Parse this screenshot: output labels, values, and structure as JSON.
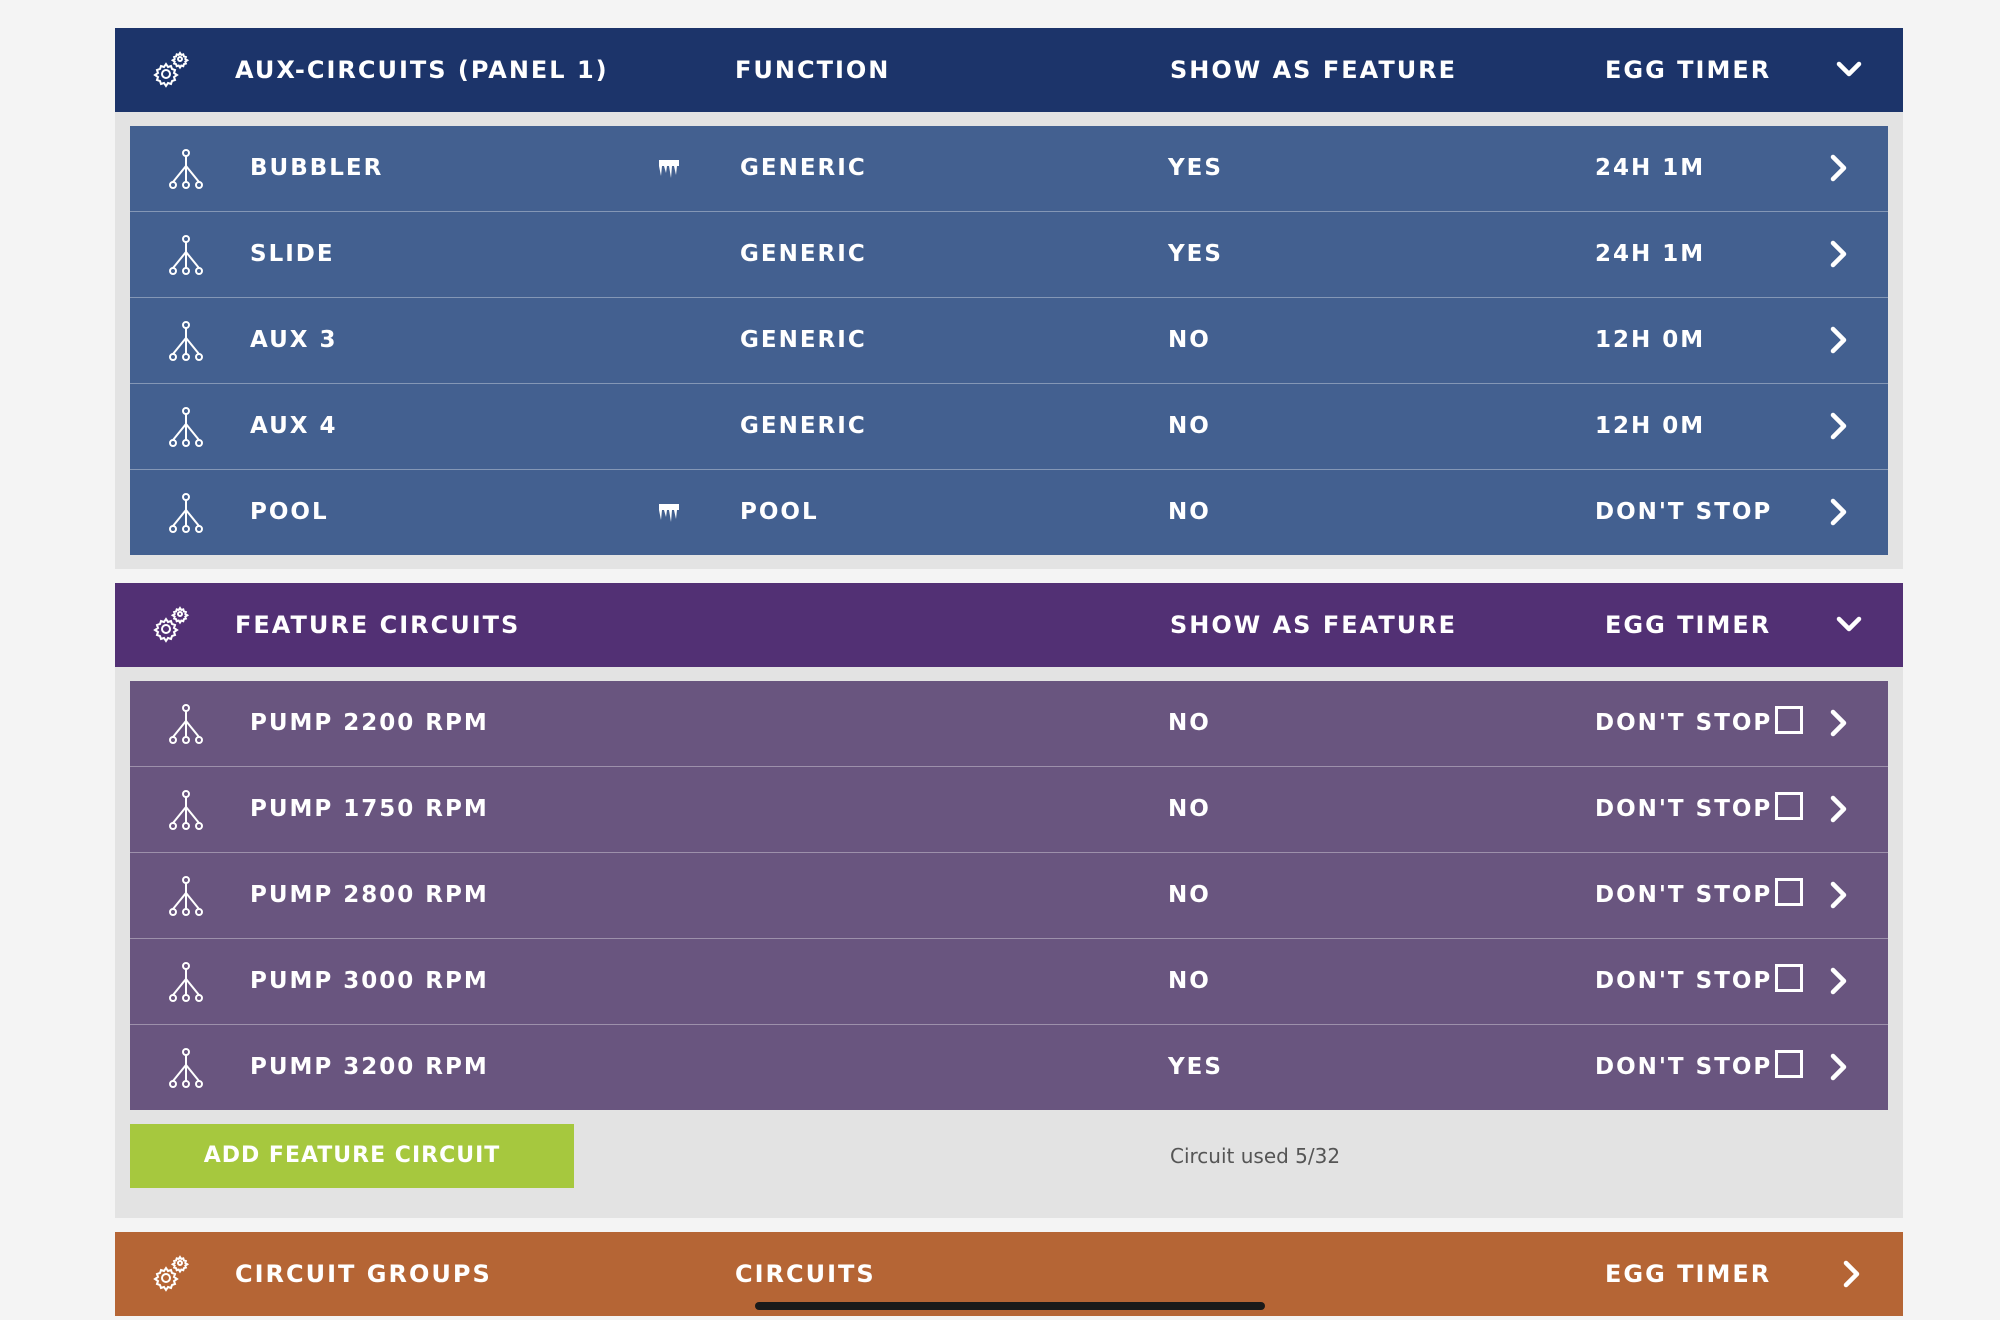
{
  "aux_section": {
    "title": "AUX-CIRCUITS (PANEL 1)",
    "col_function": "FUNCTION",
    "col_show": "SHOW AS FEATURE",
    "col_timer": "EGG TIMER",
    "rows": [
      {
        "name": "BUBBLER",
        "freeze": true,
        "function": "GENERIC",
        "show": "YES",
        "timer": "24H 1M"
      },
      {
        "name": "SLIDE",
        "freeze": false,
        "function": "GENERIC",
        "show": "YES",
        "timer": "24H 1M"
      },
      {
        "name": "AUX 3",
        "freeze": false,
        "function": "GENERIC",
        "show": "NO",
        "timer": "12H 0M"
      },
      {
        "name": "AUX 4",
        "freeze": false,
        "function": "GENERIC",
        "show": "NO",
        "timer": "12H 0M"
      },
      {
        "name": "POOL",
        "freeze": true,
        "function": "POOL",
        "show": "NO",
        "timer": "DON'T STOP"
      }
    ]
  },
  "feature_section": {
    "title": "FEATURE CIRCUITS",
    "col_show": "SHOW AS FEATURE",
    "col_timer": "EGG TIMER",
    "rows": [
      {
        "name": "PUMP 2200 RPM",
        "show": "NO",
        "timer": "DON'T STOP"
      },
      {
        "name": "PUMP 1750 RPM",
        "show": "NO",
        "timer": "DON'T STOP"
      },
      {
        "name": "PUMP 2800 RPM",
        "show": "NO",
        "timer": "DON'T STOP"
      },
      {
        "name": "PUMP 3000 RPM",
        "show": "NO",
        "timer": "DON'T STOP"
      },
      {
        "name": "PUMP 3200 RPM",
        "show": "YES",
        "timer": "DON'T STOP"
      }
    ],
    "add_button": "ADD FEATURE CIRCUIT",
    "circuit_used": "Circuit used 5/32"
  },
  "groups_section": {
    "title": "CIRCUIT GROUPS",
    "col_circuits": "CIRCUITS",
    "col_timer": "EGG TIMER"
  },
  "colors": {
    "aux_header": "#1c346a",
    "aux_row": "#436090",
    "feature_header": "#523074",
    "feature_row": "#69557f",
    "groups_header": "#b56535",
    "add_button": "#a6c83e"
  },
  "icons": {
    "header": "gear-icon",
    "row": "circuit-tree-icon",
    "freeze": "freeze-protection-icon",
    "expand": "chevron-down-icon",
    "navigate": "chevron-right-icon"
  }
}
